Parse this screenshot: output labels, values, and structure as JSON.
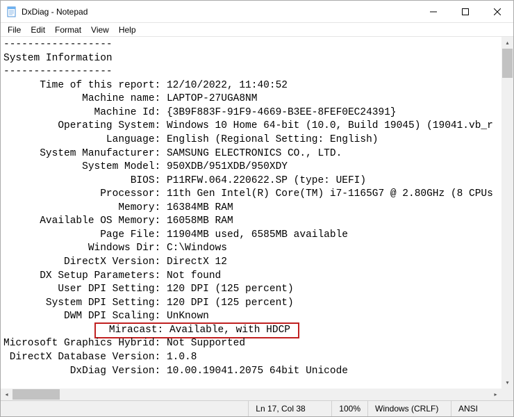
{
  "window": {
    "title": "DxDiag - Notepad"
  },
  "menu": {
    "file": "File",
    "edit": "Edit",
    "format": "Format",
    "view": "View",
    "help": "Help"
  },
  "content": {
    "dashes1": "------------------",
    "section_heading": "System Information",
    "dashes2": "------------------",
    "rows": [
      {
        "label": "      Time of this report:",
        "value": " 12/10/2022, 11:40:52"
      },
      {
        "label": "             Machine name:",
        "value": " LAPTOP-27UGA8NM"
      },
      {
        "label": "               Machine Id:",
        "value": " {3B9F883F-91F9-4669-B3EE-8FEF0EC24391}"
      },
      {
        "label": "         Operating System:",
        "value": " Windows 10 Home 64-bit (10.0, Build 19045) (19041.vb_r"
      },
      {
        "label": "                 Language:",
        "value": " English (Regional Setting: English)"
      },
      {
        "label": "      System Manufacturer:",
        "value": " SAMSUNG ELECTRONICS CO., LTD."
      },
      {
        "label": "             System Model:",
        "value": " 950XDB/951XDB/950XDY"
      },
      {
        "label": "                     BIOS:",
        "value": " P11RFW.064.220622.SP (type: UEFI)"
      },
      {
        "label": "                Processor:",
        "value": " 11th Gen Intel(R) Core(TM) i7-1165G7 @ 2.80GHz (8 CPUs"
      },
      {
        "label": "                   Memory:",
        "value": " 16384MB RAM"
      },
      {
        "label": "      Available OS Memory:",
        "value": " 16058MB RAM"
      },
      {
        "label": "                Page File:",
        "value": " 11904MB used, 6585MB available"
      },
      {
        "label": "              Windows Dir:",
        "value": " C:\\Windows"
      },
      {
        "label": "          DirectX Version:",
        "value": " DirectX 12"
      },
      {
        "label": "      DX Setup Parameters:",
        "value": " Not found"
      },
      {
        "label": "         User DPI Setting:",
        "value": " 120 DPI (125 percent)"
      },
      {
        "label": "       System DPI Setting:",
        "value": " 120 DPI (125 percent)"
      },
      {
        "label": "          DWM DPI Scaling:",
        "value": " UnKnown"
      }
    ],
    "miracast_label": "                 Miracast:",
    "miracast_value": " Available, with HDCP ",
    "rows2": [
      {
        "label": "Microsoft Graphics Hybrid:",
        "value": " Not Supported"
      },
      {
        "label": " DirectX Database Version:",
        "value": " 1.0.8"
      },
      {
        "label": "           DxDiag Version:",
        "value": " 10.00.19041.2075 64bit Unicode"
      }
    ]
  },
  "status": {
    "position": "Ln 17, Col 38",
    "zoom": "100%",
    "lineending": "Windows (CRLF)",
    "encoding": "ANSI"
  }
}
